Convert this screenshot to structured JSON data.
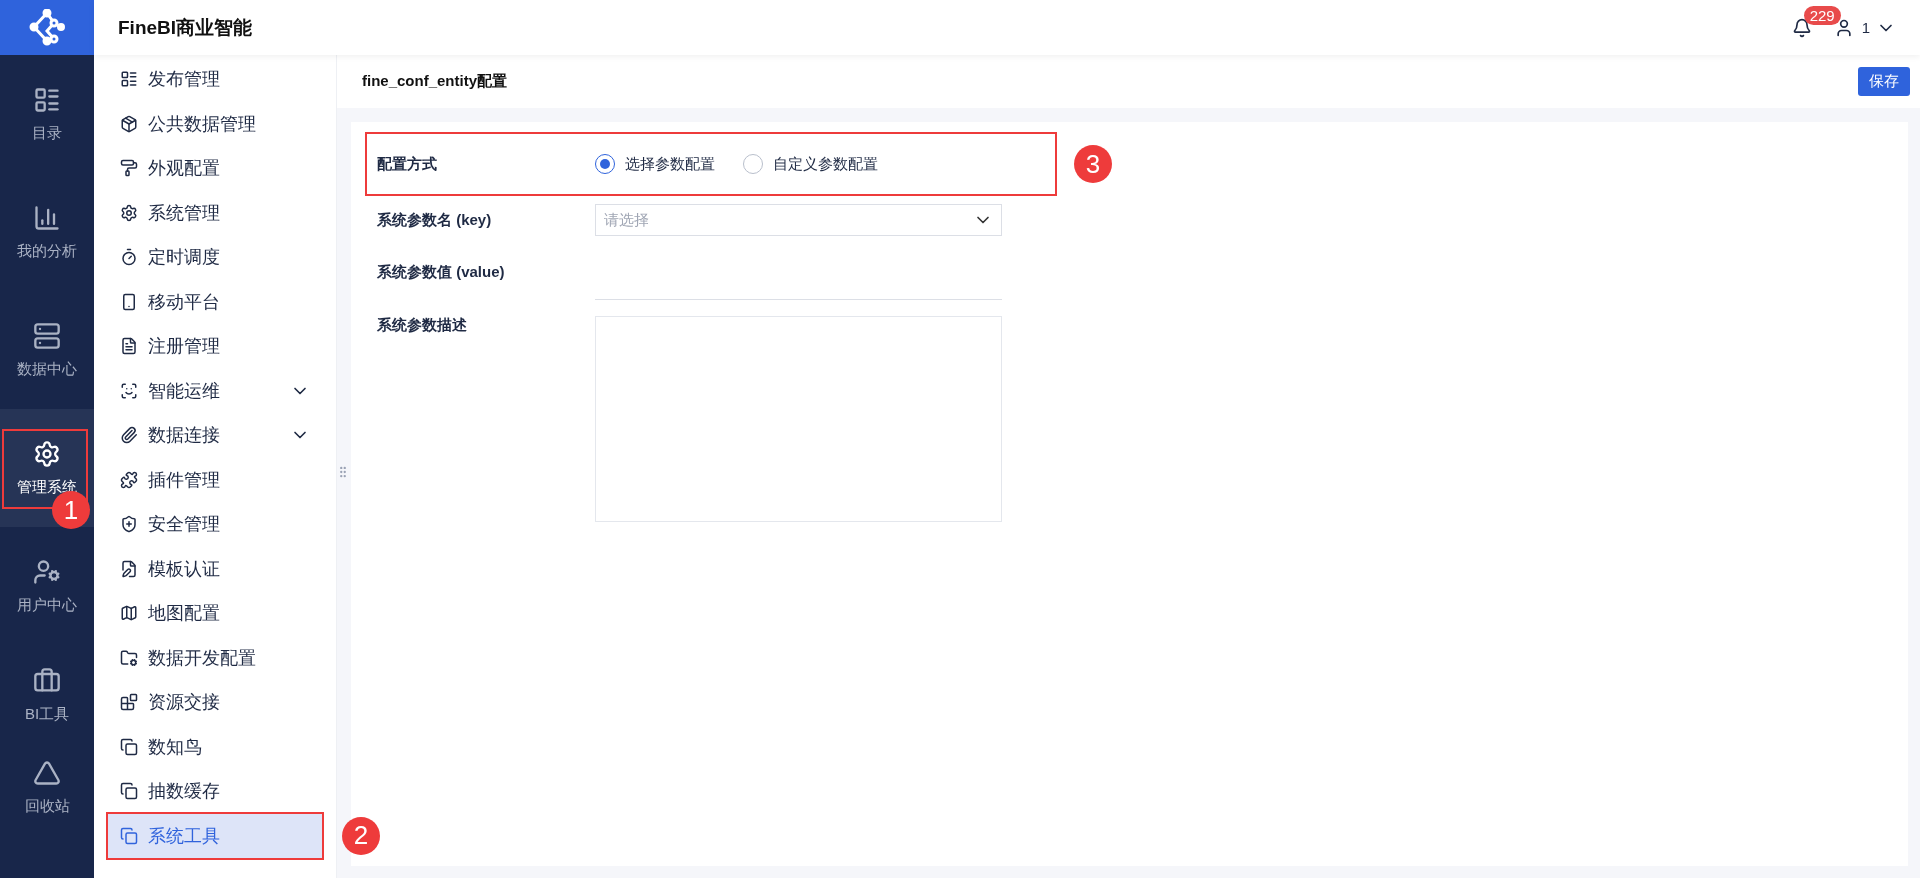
{
  "header": {
    "title": "FineBI商业智能",
    "notifications": "229",
    "user": "1"
  },
  "nav": [
    {
      "label": "目录",
      "selected": false
    },
    {
      "label": "我的分析",
      "selected": false
    },
    {
      "label": "数据中心",
      "selected": false
    },
    {
      "label": "管理系统",
      "selected": true,
      "callout": "1"
    },
    {
      "label": "用户中心",
      "selected": false
    },
    {
      "label": "BI工具",
      "selected": false
    },
    {
      "label": "回收站",
      "selected": false
    }
  ],
  "sidebar": [
    {
      "label": "发布管理",
      "kind": "item",
      "selected": false
    },
    {
      "label": "公共数据管理",
      "kind": "item",
      "selected": false
    },
    {
      "label": "外观配置",
      "kind": "item",
      "selected": false
    },
    {
      "label": "系统管理",
      "kind": "item",
      "selected": false
    },
    {
      "label": "定时调度",
      "kind": "item",
      "selected": false
    },
    {
      "label": "移动平台",
      "kind": "item",
      "selected": false
    },
    {
      "label": "注册管理",
      "kind": "item",
      "selected": false
    },
    {
      "label": "智能运维",
      "kind": "group",
      "selected": false
    },
    {
      "label": "数据连接",
      "kind": "group",
      "selected": false
    },
    {
      "label": "插件管理",
      "kind": "item",
      "selected": false
    },
    {
      "label": "安全管理",
      "kind": "item",
      "selected": false
    },
    {
      "label": "模板认证",
      "kind": "item",
      "selected": false
    },
    {
      "label": "地图配置",
      "kind": "item",
      "selected": false
    },
    {
      "label": "数据开发配置",
      "kind": "item",
      "selected": false
    },
    {
      "label": "资源交接",
      "kind": "item",
      "selected": false
    },
    {
      "label": "数知鸟",
      "kind": "item",
      "selected": false
    },
    {
      "label": "抽数缓存",
      "kind": "item",
      "selected": false
    },
    {
      "label": "系统工具",
      "kind": "item",
      "selected": true,
      "callout": "2"
    }
  ],
  "page": {
    "title": "fine_conf_entity配置",
    "save": "保存"
  },
  "form": {
    "mode": {
      "label": "配置方式",
      "callout": "3",
      "options": [
        {
          "label": "选择参数配置",
          "selected": true
        },
        {
          "label": "自定义参数配置",
          "selected": false
        }
      ]
    },
    "key": {
      "label": "系统参数名 (key)",
      "placeholder": "请选择"
    },
    "value": {
      "label": "系统参数值 (value)"
    },
    "description": {
      "label": "系统参数描述"
    }
  }
}
